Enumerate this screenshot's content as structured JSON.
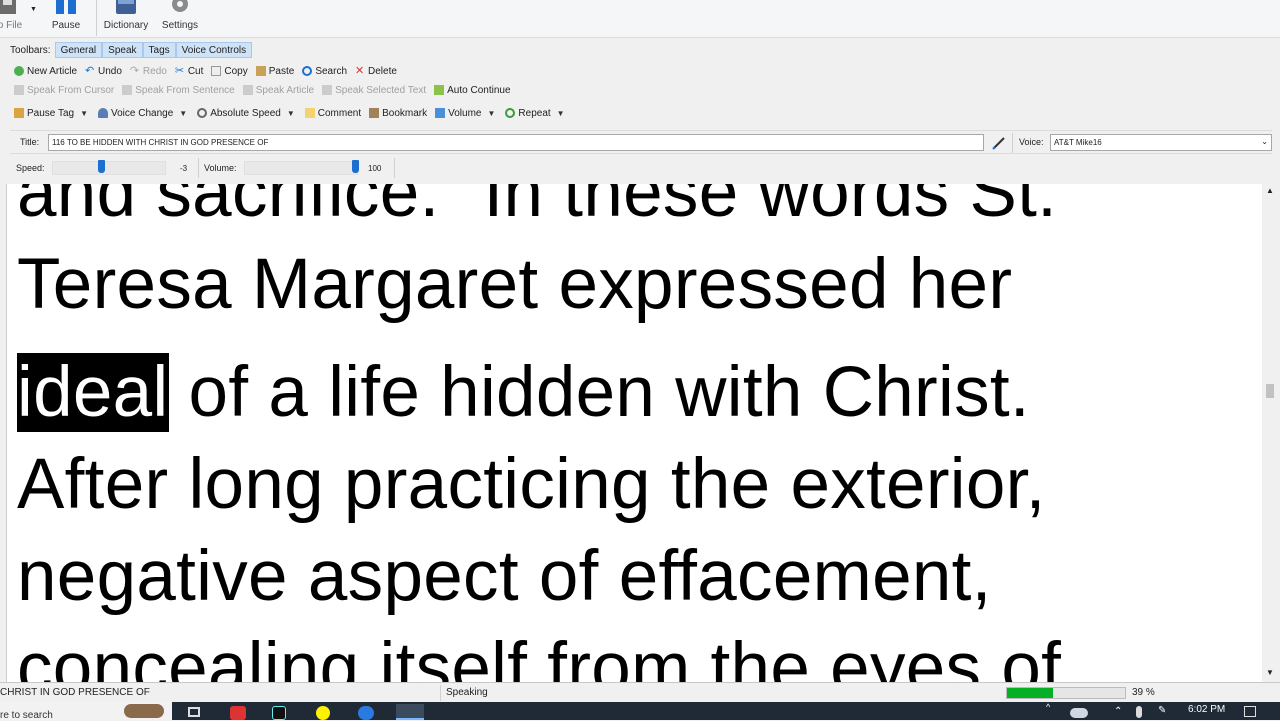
{
  "ribbon": {
    "file_label": "o File",
    "pause_label": "Pause",
    "dictionary_label": "Dictionary",
    "settings_label": "Settings"
  },
  "toolbars": {
    "label": "Toolbars:",
    "tabs": [
      "General",
      "Speak",
      "Tags",
      "Voice Controls"
    ]
  },
  "general_row": [
    "New Article",
    "Undo",
    "Redo",
    "Cut",
    "Copy",
    "Paste",
    "Search",
    "Delete"
  ],
  "speak_row": [
    "Speak From Cursor",
    "Speak From Sentence",
    "Speak Article",
    "Speak Selected Text",
    "Auto Continue"
  ],
  "tags_row": [
    "Pause Tag",
    "Voice Change",
    "Absolute Speed",
    "Comment",
    "Bookmark",
    "Volume",
    "Repeat"
  ],
  "title": {
    "label": "Title:",
    "value": "116 TO BE HIDDEN WITH CHRIST IN GOD PRESENCE OF"
  },
  "voice": {
    "label": "Voice:",
    "value": "AT&T Mike16"
  },
  "speed": {
    "label": "Speed:",
    "value": "-3",
    "level": 0.42
  },
  "volume": {
    "label": "Volume:",
    "value": "100",
    "level": 1.0
  },
  "document": {
    "line1": "and sacrifice.” In these words St.",
    "line2": "Teresa Margaret expressed her",
    "line3_highlight": "ideal",
    "line3_rest": " of a life hidden with Christ.",
    "line4": "After long practicing the exterior,",
    "line5": "negative aspect of effacement,",
    "line6": "concealing itself from the eyes of"
  },
  "status": {
    "left": "CHRIST IN GOD PRESENCE OF",
    "state": "Speaking",
    "progress_percent": 39,
    "progress_text": "39 %"
  },
  "taskbar": {
    "search_text": "re to search",
    "time": "6:02 PM"
  },
  "colors": {
    "tab_bg": "#cfe3f8",
    "accent_blue": "#1c6fd1",
    "progress_green": "#06b025",
    "highlight": "#000000"
  }
}
